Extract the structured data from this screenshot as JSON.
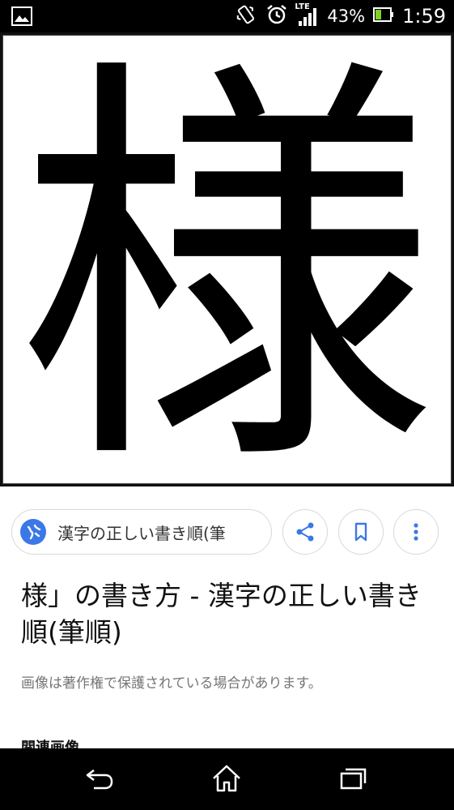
{
  "status_bar": {
    "network": "LTE",
    "battery_percent": "43%",
    "battery_level": 0.43,
    "time": "1:59",
    "icons": [
      "gallery-notification-icon",
      "vibrate-icon",
      "alarm-icon",
      "signal-icon",
      "battery-icon"
    ]
  },
  "image": {
    "character": "様"
  },
  "source": {
    "label": "漢字の正しい書き順(筆"
  },
  "actions": {
    "icons": [
      "share-icon",
      "bookmark-icon",
      "more-vert-icon"
    ]
  },
  "result": {
    "title": "様」の書き方 - 漢字の正しい書き順(筆順)",
    "copyright_note": "画像は著作権で保護されている場合があります。",
    "related_heading": "関連画像"
  },
  "colors": {
    "accent": "#3b78e7",
    "text": "#111111",
    "muted": "#757575"
  },
  "nav_bar": {
    "icons": [
      "back-icon",
      "home-icon",
      "recents-icon"
    ]
  }
}
